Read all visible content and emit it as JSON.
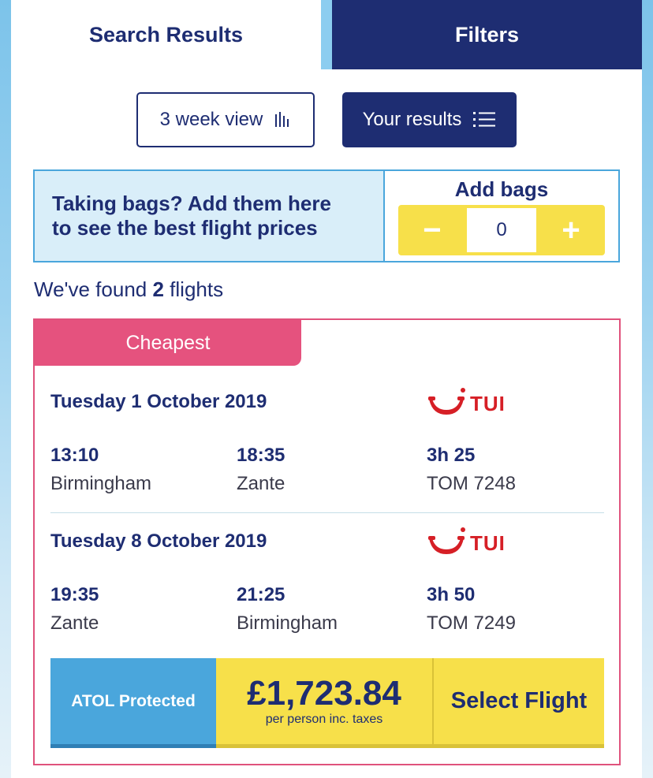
{
  "tabs": {
    "search_results": "Search Results",
    "filters": "Filters"
  },
  "view_buttons": {
    "week_view": "3 week view",
    "your_results": "Your results"
  },
  "bags": {
    "message": "Taking bags? Add them here\nto see the best flight prices",
    "title": "Add bags",
    "minus": "−",
    "plus": "+",
    "count": "0"
  },
  "summary": {
    "prefix": "We've found ",
    "count": "2",
    "suffix": " flights"
  },
  "card": {
    "badge": "Cheapest",
    "airline_text": "TUI",
    "outbound": {
      "date": "Tuesday 1 October 2019",
      "depart_time": "13:10",
      "depart_place": "Birmingham",
      "arrive_time": "18:35",
      "arrive_place": "Zante",
      "duration": "3h 25",
      "flight_number": "TOM 7248"
    },
    "return": {
      "date": "Tuesday 8 October 2019",
      "depart_time": "19:35",
      "depart_place": "Zante",
      "arrive_time": "21:25",
      "arrive_place": "Birmingham",
      "duration": "3h 50",
      "flight_number": "TOM 7249"
    },
    "atol": "ATOL Protected",
    "price": "£1,723.84",
    "price_note": "per person inc. taxes",
    "select": "Select Flight"
  },
  "colors": {
    "navy": "#1e2d72",
    "pink": "#e5527e",
    "blue": "#4aa6dc",
    "yellow": "#f7e04a",
    "tui_red": "#d61f26"
  }
}
